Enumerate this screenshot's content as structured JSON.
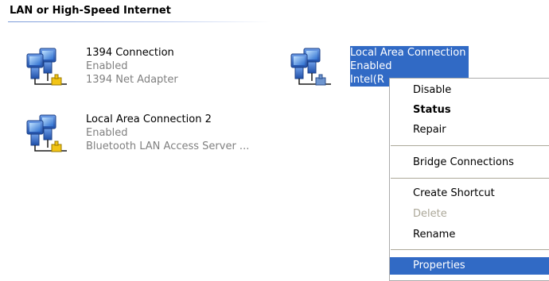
{
  "group": {
    "title": "LAN or High-Speed Internet"
  },
  "connections": [
    {
      "name": "1394 Connection",
      "status": "Enabled",
      "device": "1394 Net Adapter",
      "icon": "network-connection-icon"
    },
    {
      "name": "Local Area Connection 2",
      "status": "Enabled",
      "device": "Bluetooth LAN Access Server ...",
      "icon": "network-connection-icon"
    },
    {
      "name": "Local Area Connection",
      "status": "Enabled",
      "device": "Intel(R",
      "icon": "network-connection-icon",
      "selected": true
    }
  ],
  "context_menu": {
    "items": [
      {
        "label": "Disable",
        "style": "normal"
      },
      {
        "label": "Status",
        "style": "bold"
      },
      {
        "label": "Repair",
        "style": "normal"
      },
      {
        "label": "Bridge Connections",
        "style": "normal"
      },
      {
        "label": "Create Shortcut",
        "style": "normal"
      },
      {
        "label": "Delete",
        "style": "disabled"
      },
      {
        "label": "Rename",
        "style": "normal"
      },
      {
        "label": "Properties",
        "style": "highlighted"
      }
    ]
  },
  "colors": {
    "selection": "#316ac5",
    "disabled_text": "#aca899",
    "secondary_text": "#808080"
  }
}
